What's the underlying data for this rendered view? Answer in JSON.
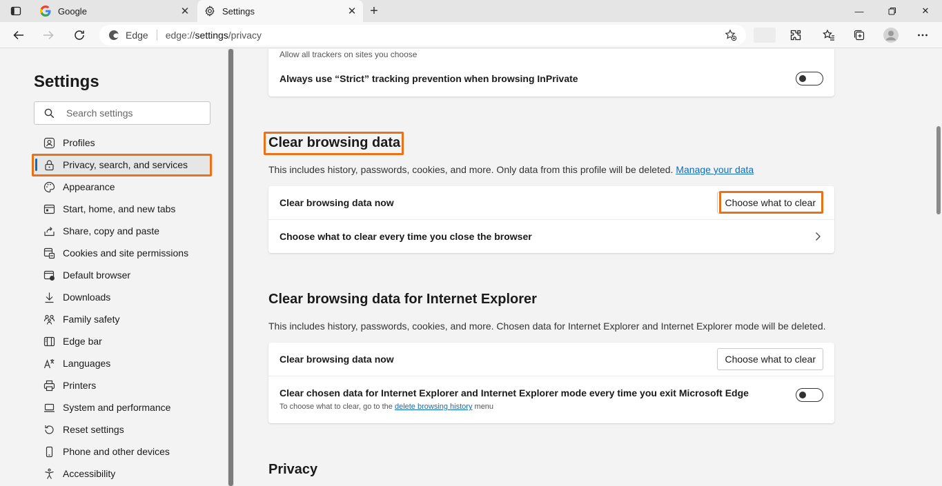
{
  "tabs": [
    {
      "title": "Google",
      "active": false
    },
    {
      "title": "Settings",
      "active": true
    }
  ],
  "address": {
    "edge_label": "Edge",
    "url_prefix": "edge://",
    "url_bold": "settings",
    "url_suffix": "/privacy"
  },
  "sidebar": {
    "title": "Settings",
    "search_placeholder": "Search settings",
    "items": [
      {
        "label": "Profiles",
        "icon": "profile-icon"
      },
      {
        "label": "Privacy, search, and services",
        "icon": "lock-icon",
        "active": true
      },
      {
        "label": "Appearance",
        "icon": "palette-icon"
      },
      {
        "label": "Start, home, and new tabs",
        "icon": "home-tabs-icon"
      },
      {
        "label": "Share, copy and paste",
        "icon": "share-icon"
      },
      {
        "label": "Cookies and site permissions",
        "icon": "cookies-icon"
      },
      {
        "label": "Default browser",
        "icon": "default-browser-icon"
      },
      {
        "label": "Downloads",
        "icon": "download-icon"
      },
      {
        "label": "Family safety",
        "icon": "family-icon"
      },
      {
        "label": "Edge bar",
        "icon": "edge-bar-icon"
      },
      {
        "label": "Languages",
        "icon": "languages-icon"
      },
      {
        "label": "Printers",
        "icon": "printer-icon"
      },
      {
        "label": "System and performance",
        "icon": "laptop-icon"
      },
      {
        "label": "Reset settings",
        "icon": "reset-icon"
      },
      {
        "label": "Phone and other devices",
        "icon": "phone-icon"
      },
      {
        "label": "Accessibility",
        "icon": "accessibility-icon"
      }
    ]
  },
  "tracking": {
    "allow_trackers_sub": "Allow all trackers on sites you choose",
    "strict_inprivate_label": "Always use “Strict” tracking prevention when browsing InPrivate",
    "strict_inprivate_on": false
  },
  "clear_data": {
    "heading": "Clear browsing data",
    "desc": "This includes history, passwords, cookies, and more. Only data from this profile will be deleted.",
    "manage_link": "Manage your data",
    "now_label": "Clear browsing data now",
    "choose_button": "Choose what to clear",
    "every_close_label": "Choose what to clear every time you close the browser"
  },
  "clear_ie": {
    "heading": "Clear browsing data for Internet Explorer",
    "desc": "This includes history, passwords, cookies, and more. Chosen data for Internet Explorer and Internet Explorer mode will be deleted.",
    "now_label": "Clear browsing data now",
    "choose_button": "Choose what to clear",
    "exit_label": "Clear chosen data for Internet Explorer and Internet Explorer mode every time you exit Microsoft Edge",
    "exit_sub_prefix": "To choose what to clear, go to the",
    "exit_sub_link": "delete browsing history",
    "exit_sub_suffix": "menu",
    "exit_on": false
  },
  "privacy": {
    "heading": "Privacy"
  },
  "colors": {
    "highlight": "#e8711a",
    "link": "#0f6cbd",
    "accent": "#0f6cbd"
  }
}
